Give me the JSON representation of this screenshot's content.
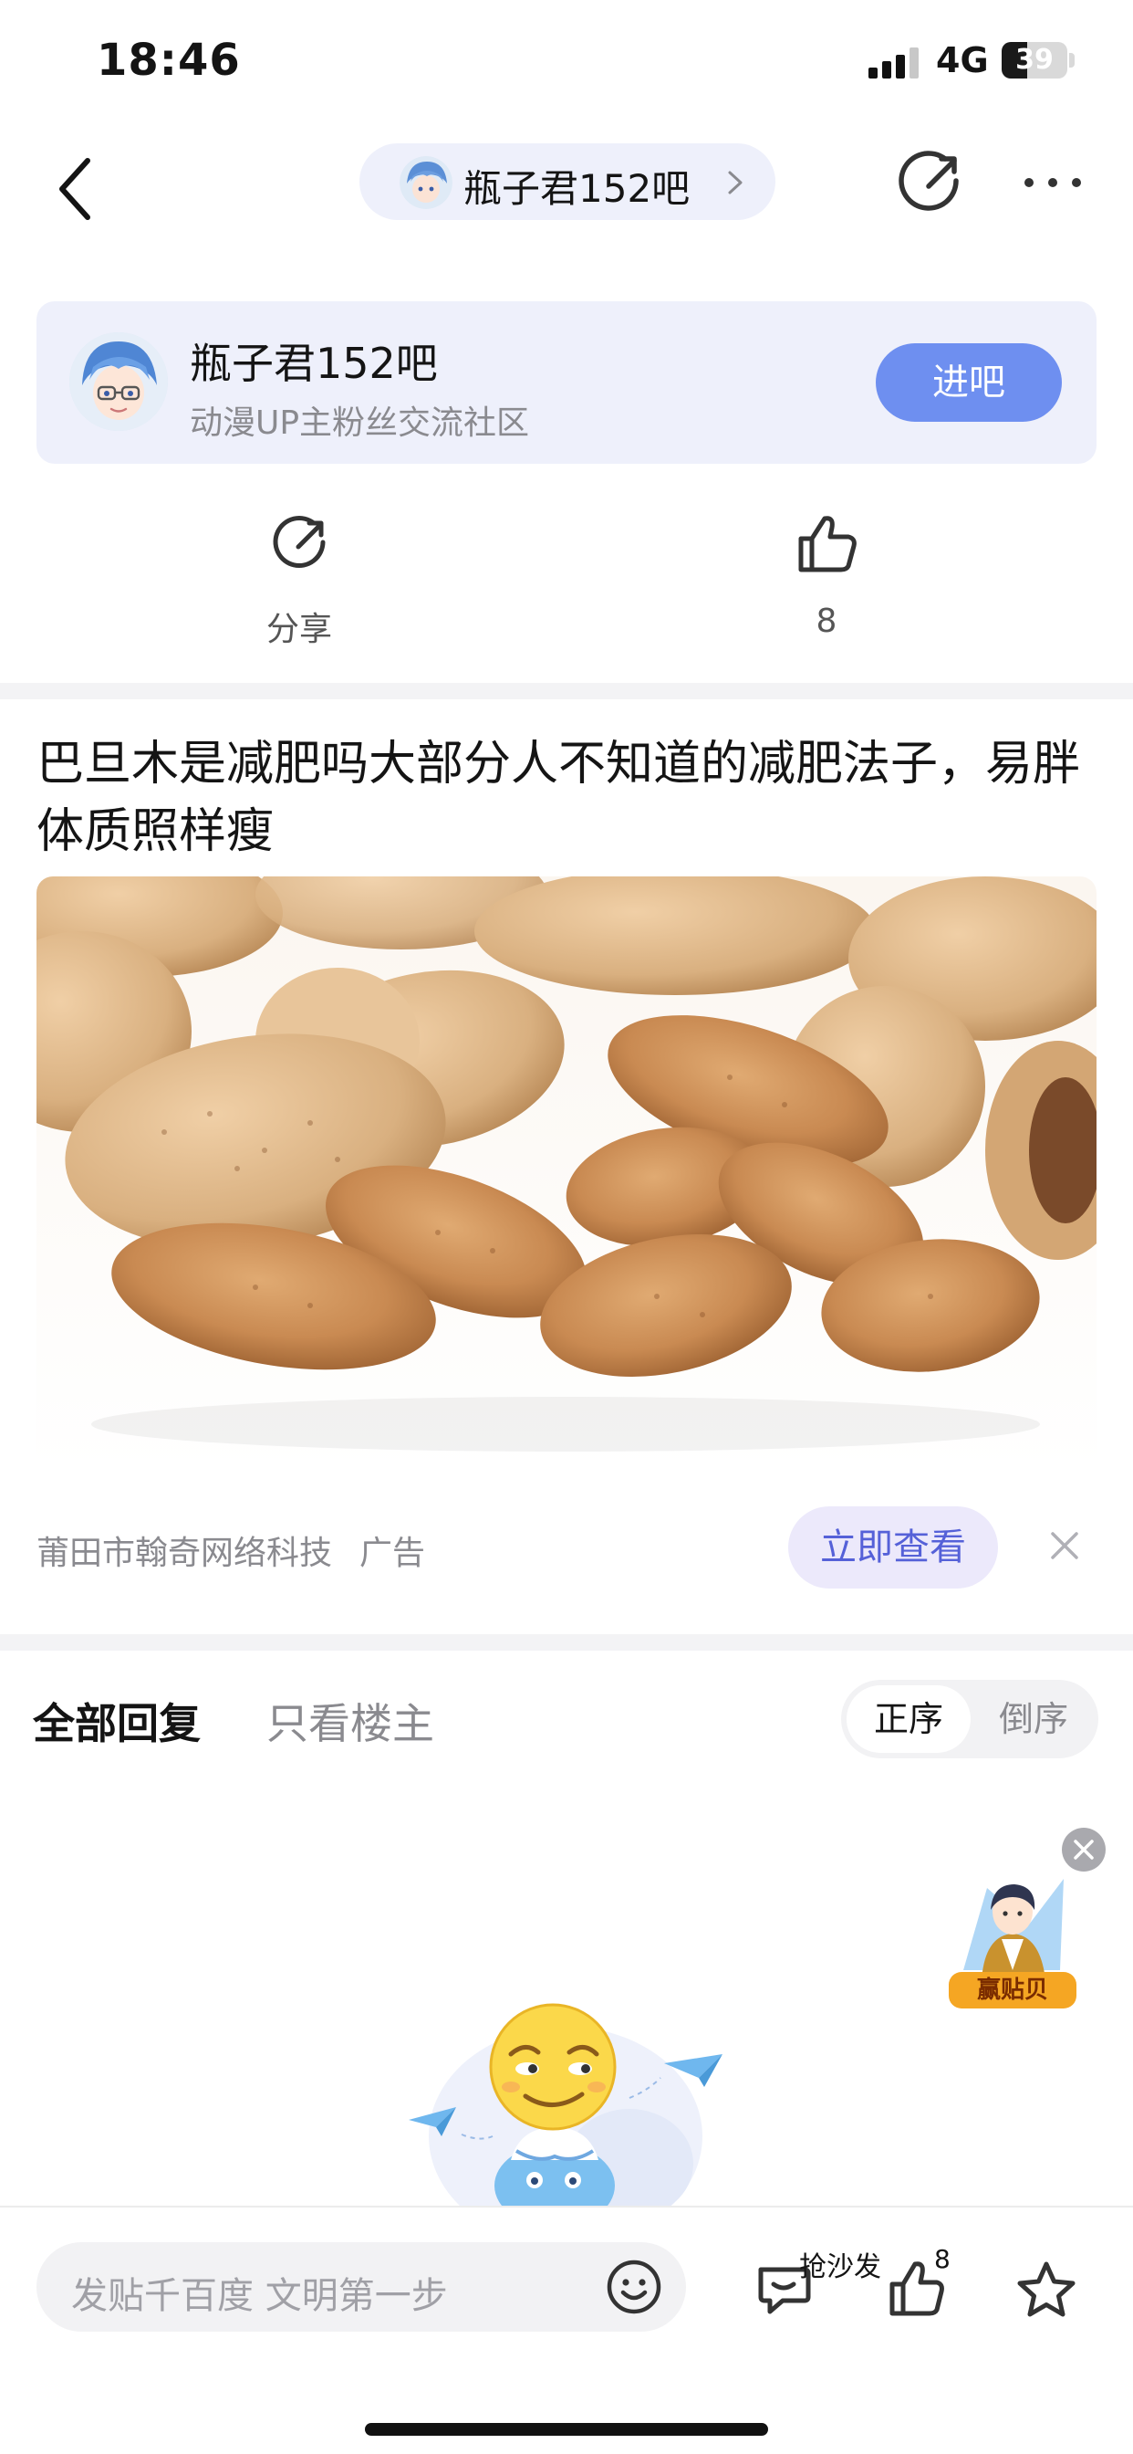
{
  "status_bar": {
    "time": "18:46",
    "network": "4G",
    "battery": "39",
    "battery_level": 0.39
  },
  "nav": {
    "forum_name": "瓶子君152吧",
    "icons": [
      "back-icon",
      "chevron-right-icon",
      "share-icon",
      "more-icon"
    ]
  },
  "forum_card": {
    "title": "瓶子君152吧",
    "subtitle": "动漫UP主粉丝交流社区",
    "join_label": "进吧"
  },
  "actions": {
    "share_label": "分享",
    "like_count": "8"
  },
  "post": {
    "title": "巴旦木是减肥吗大部分人不知道的减肥法子，易胖体质照样瘦"
  },
  "ad": {
    "advertiser": "莆田市翰奇网络科技",
    "tag": "广告",
    "cta_label": "立即查看"
  },
  "replies": {
    "tab_all": "全部回复",
    "tab_op_only": "只看楼主",
    "sort_asc": "正序",
    "sort_desc": "倒序"
  },
  "float_reward": {
    "label": "赢贴贝"
  },
  "bottom_bar": {
    "input_placeholder": "发贴千百度 文明第一步",
    "comment_label": "抢沙发",
    "like_count": "8"
  },
  "colors": {
    "accent": "#6e8ff0",
    "card_bg": "#eef0fb",
    "cta_text": "#5561d8",
    "muted_text": "#8a8a8f"
  }
}
